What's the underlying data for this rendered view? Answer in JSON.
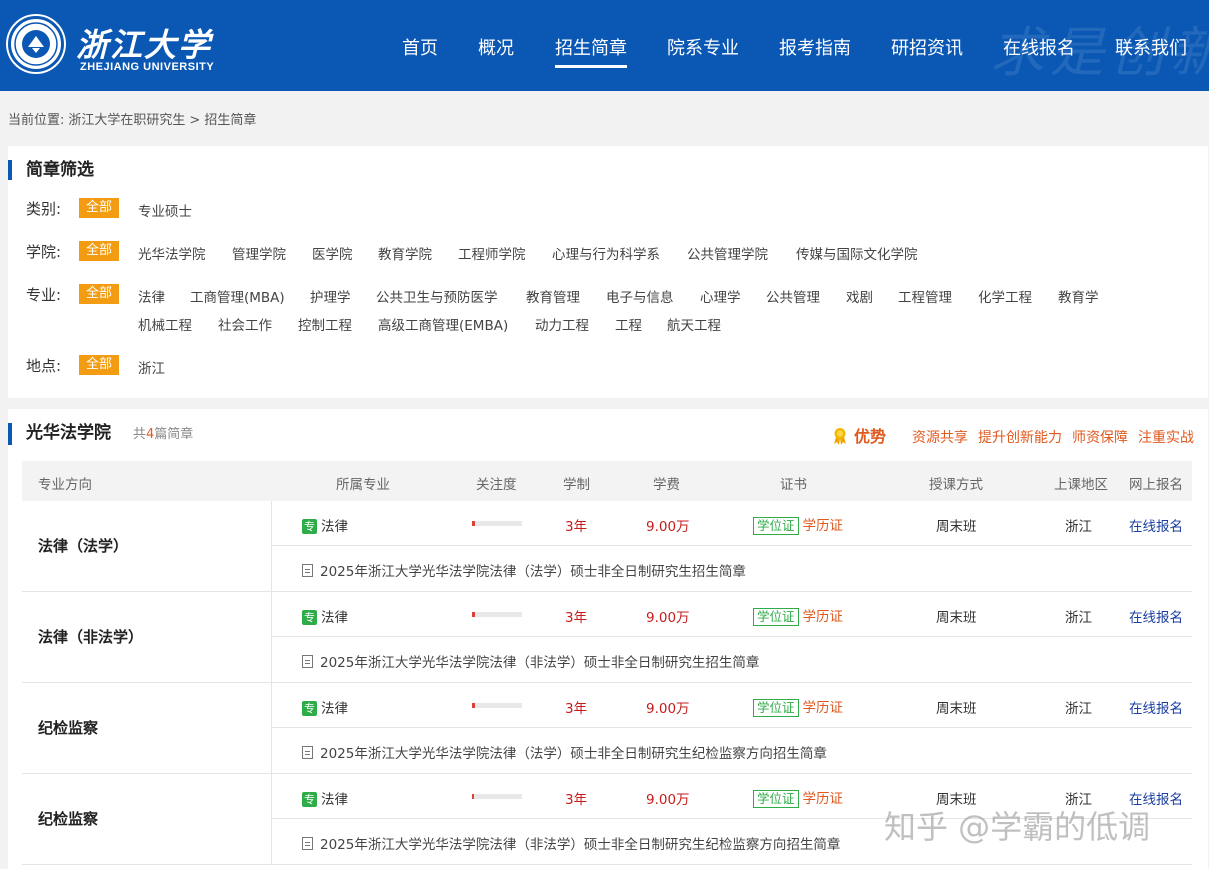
{
  "header": {
    "brand_cn": "浙江大学",
    "brand_en": "ZHEJIANG UNIVERSITY",
    "nav": [
      {
        "label": "首页"
      },
      {
        "label": "概况"
      },
      {
        "label": "招生简章"
      },
      {
        "label": "院系专业"
      },
      {
        "label": "报考指南"
      },
      {
        "label": "研招资讯"
      },
      {
        "label": "在线报名"
      },
      {
        "label": "联系我们"
      }
    ],
    "active_nav": "招生简章",
    "accent": "#0a57b4"
  },
  "breadcrumb": {
    "prefix": "当前位置:",
    "items": [
      "浙江大学在职研究生",
      "招生简章"
    ],
    "separator": ">"
  },
  "filter": {
    "title": "简章筛选",
    "all_label": "全部",
    "category": {
      "label": "类别:",
      "options": [
        "专业硕士"
      ]
    },
    "college": {
      "label": "学院:",
      "options": [
        "光华法学院",
        "管理学院",
        "医学院",
        "教育学院",
        "工程师学院",
        "心理与行为科学系",
        "公共管理学院",
        "传媒与国际文化学院"
      ]
    },
    "major": {
      "label": "专业:",
      "options": [
        "法律",
        "工商管理(MBA)",
        "护理学",
        "公共卫生与预防医学",
        "教育管理",
        "电子与信息",
        "心理学",
        "公共管理",
        "戏剧",
        "工程管理",
        "化学工程",
        "教育学",
        "机械工程",
        "社会工作",
        "控制工程",
        "高级工商管理(EMBA)",
        "动力工程",
        "工程",
        "航天工程"
      ]
    },
    "location": {
      "label": "地点:",
      "options": [
        "浙江"
      ]
    }
  },
  "list": {
    "title": "光华法学院",
    "count_prefix": "共",
    "count": "4",
    "count_suffix": "篇简章",
    "advantage": {
      "title": "优势",
      "items": [
        "资源共享",
        "提升创新能力",
        "师资保障",
        "注重实战"
      ]
    },
    "columns": [
      "专业方向",
      "所属专业",
      "关注度",
      "学制",
      "学费",
      "证书",
      "授课方式",
      "上课地区",
      "网上报名"
    ],
    "rows": [
      {
        "direction": "法律（法学）",
        "tag": "专",
        "major": "法律",
        "attention": 0.06,
        "duration": "3年",
        "fee": "9.00万",
        "cert_badge": "学位证",
        "cert_text": "学历证",
        "mode": "周末班",
        "region": "浙江",
        "signup": "在线报名",
        "doc": "2025年浙江大学光华法学院法律（法学）硕士非全日制研究生招生简章"
      },
      {
        "direction": "法律（非法学）",
        "tag": "专",
        "major": "法律",
        "attention": 0.06,
        "duration": "3年",
        "fee": "9.00万",
        "cert_badge": "学位证",
        "cert_text": "学历证",
        "mode": "周末班",
        "region": "浙江",
        "signup": "在线报名",
        "doc": "2025年浙江大学光华法学院法律（非法学）硕士非全日制研究生招生简章"
      },
      {
        "direction": "纪检监察",
        "tag": "专",
        "major": "法律",
        "attention": 0.05,
        "duration": "3年",
        "fee": "9.00万",
        "cert_badge": "学位证",
        "cert_text": "学历证",
        "mode": "周末班",
        "region": "浙江",
        "signup": "在线报名",
        "doc": "2025年浙江大学光华法学院法律（法学）硕士非全日制研究生纪检监察方向招生简章"
      },
      {
        "direction": "纪检监察",
        "tag": "专",
        "major": "法律",
        "attention": 0.04,
        "duration": "3年",
        "fee": "9.00万",
        "cert_badge": "学位证",
        "cert_text": "学历证",
        "mode": "周末班",
        "region": "浙江",
        "signup": "在线报名",
        "doc": "2025年浙江大学光华法学院法律（非法学）硕士非全日制研究生纪检监察方向招生简章"
      }
    ]
  },
  "watermark": "知乎 @学霸的低调"
}
